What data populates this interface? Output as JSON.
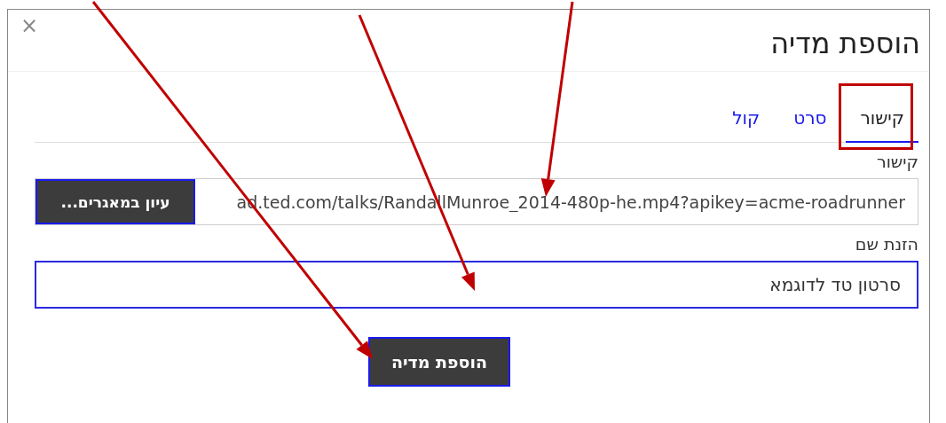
{
  "dialog": {
    "title": "הוספת מדיה",
    "close": "×"
  },
  "tabs": [
    {
      "label": "קישור",
      "selected": true
    },
    {
      "label": "סרט",
      "selected": false
    },
    {
      "label": "קול",
      "selected": false
    }
  ],
  "link_field": {
    "label": "קישור",
    "value": "ad.ted.com/talks/RandallMunroe_2014-480p-he.mp4?apikey=acme-roadrunner",
    "browse_button": "עיון במאגרים..."
  },
  "name_field": {
    "label": "הזנת שם",
    "value": "סרטון טד לדוגמא"
  },
  "submit_button": "הוספת מדיה"
}
